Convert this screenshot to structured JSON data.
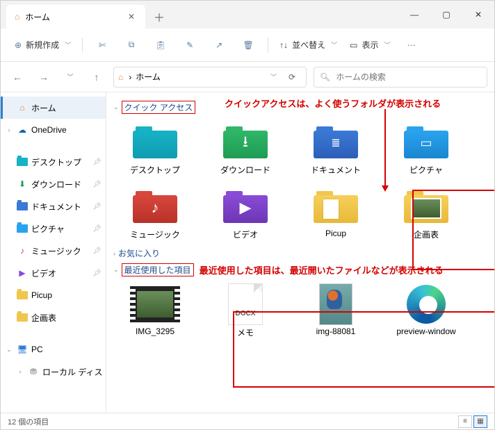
{
  "titlebar": {
    "tab_title": "ホーム"
  },
  "toolbar": {
    "new_label": "新規作成",
    "sort_label": "並べ替え",
    "view_label": "表示"
  },
  "nav": {
    "breadcrumb_sep": "›",
    "breadcrumb": "ホーム",
    "search_placeholder": "ホームの検索"
  },
  "sidebar": {
    "home": "ホーム",
    "onedrive": "OneDrive",
    "pinned": [
      {
        "label": "デスクトップ"
      },
      {
        "label": "ダウンロード"
      },
      {
        "label": "ドキュメント"
      },
      {
        "label": "ピクチャ"
      },
      {
        "label": "ミュージック"
      },
      {
        "label": "ビデオ"
      },
      {
        "label": "Picup"
      },
      {
        "label": "企画表"
      }
    ],
    "pc": "PC",
    "localdisk": "ローカル ディスク"
  },
  "sections": {
    "quick_access": "クイック アクセス",
    "favorites": "お気に入り",
    "recent": "最近使用した項目"
  },
  "annotations": {
    "quick_access_note": "クイックアクセスは、よく使うフォルダが表示される",
    "recent_note": "最近使用した項目は、最近開いたファイルなどが表示される"
  },
  "quick_items": [
    {
      "label": "デスクトップ"
    },
    {
      "label": "ダウンロード"
    },
    {
      "label": "ドキュメント"
    },
    {
      "label": "ピクチャ"
    },
    {
      "label": "ミュージック"
    },
    {
      "label": "ビデオ"
    },
    {
      "label": "Picup"
    },
    {
      "label": "企画表"
    }
  ],
  "recent_items": [
    {
      "label": "IMG_3295"
    },
    {
      "label": "メモ"
    },
    {
      "label": "img-88081"
    },
    {
      "label": "preview-window"
    }
  ],
  "status": {
    "count_label": "12 個の項目"
  },
  "docx_badge": "DOCX"
}
